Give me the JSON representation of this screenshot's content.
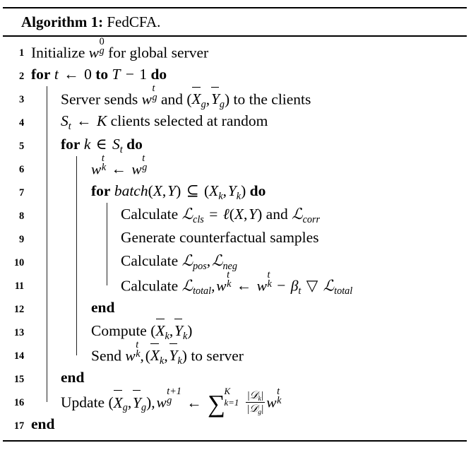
{
  "algorithm": {
    "caption_label": "Algorithm 1:",
    "caption_name": "FedCFA.",
    "lines": [
      {
        "no": "1",
        "indent": 0,
        "bars": [],
        "text": "Initialize w_g^0 for global server"
      },
      {
        "no": "2",
        "indent": 0,
        "bars": [],
        "text": "for t ← 0 to T − 1 do"
      },
      {
        "no": "3",
        "indent": 1,
        "bars": [
          "b1"
        ],
        "text": "Server sends w_g^t and (X̄_g, Ȳ_g) to the clients"
      },
      {
        "no": "4",
        "indent": 1,
        "bars": [
          "b1"
        ],
        "text": "S_t ← K clients selected at random"
      },
      {
        "no": "5",
        "indent": 1,
        "bars": [
          "b1"
        ],
        "text": "for k ∈ S_t do"
      },
      {
        "no": "6",
        "indent": 2,
        "bars": [
          "b1",
          "b2"
        ],
        "text": "w_k^t ← w_g^t"
      },
      {
        "no": "7",
        "indent": 2,
        "bars": [
          "b1",
          "b2"
        ],
        "text": "for batch(X, Y) ⊆ (X_k, Y_k) do"
      },
      {
        "no": "8",
        "indent": 3,
        "bars": [
          "b1",
          "b2",
          "b3"
        ],
        "text": "Calculate ℒ_cls = ℓ(X, Y) and ℒ_corr"
      },
      {
        "no": "9",
        "indent": 3,
        "bars": [
          "b1",
          "b2",
          "b3"
        ],
        "text": "Generate counterfactual samples"
      },
      {
        "no": "10",
        "indent": 3,
        "bars": [
          "b1",
          "b2",
          "b3"
        ],
        "text": "Calculate ℒ_pos, ℒ_neg"
      },
      {
        "no": "11",
        "indent": 3,
        "bars": [
          "b1",
          "b2",
          "b3"
        ],
        "text": "Calculate ℒ_total, w_k^t ← w_k^t − β_t ▽ ℒ_total"
      },
      {
        "no": "12",
        "indent": 2,
        "bars": [
          "b1",
          "b2"
        ],
        "text": "end"
      },
      {
        "no": "13",
        "indent": 2,
        "bars": [
          "b1",
          "b2"
        ],
        "text": "Compute (X̄_k, Ȳ_k)"
      },
      {
        "no": "14",
        "indent": 2,
        "bars": [
          "b1",
          "b2"
        ],
        "text": "Send w_k^t, (X̄_k, Ȳ_k) to server"
      },
      {
        "no": "15",
        "indent": 1,
        "bars": [
          "b1"
        ],
        "text": "end"
      },
      {
        "no": "16",
        "indent": 1,
        "bars": [
          "b1"
        ],
        "text": "Update (X̄_g, Ȳ_g), w_g^{t+1} ← Σ_{k=1}^{K} |D_k|/|D_g| w_k^t"
      },
      {
        "no": "17",
        "indent": 0,
        "bars": [],
        "text": "end"
      }
    ],
    "keywords": [
      "for",
      "to",
      "do",
      "end"
    ],
    "symbols": {
      "assign_arrow": "←",
      "element_of": "∈",
      "subset_eq": "⊆",
      "minus": "−",
      "nabla_triangle": "▽",
      "summation": "∑",
      "beta": "β",
      "ell": "ℓ",
      "cal_L": "ℒ",
      "cal_D": "𝒟"
    },
    "colors": {
      "text": "#000000",
      "background": "#ffffff",
      "rule": "#000000",
      "indent_bar": "#222222"
    }
  }
}
